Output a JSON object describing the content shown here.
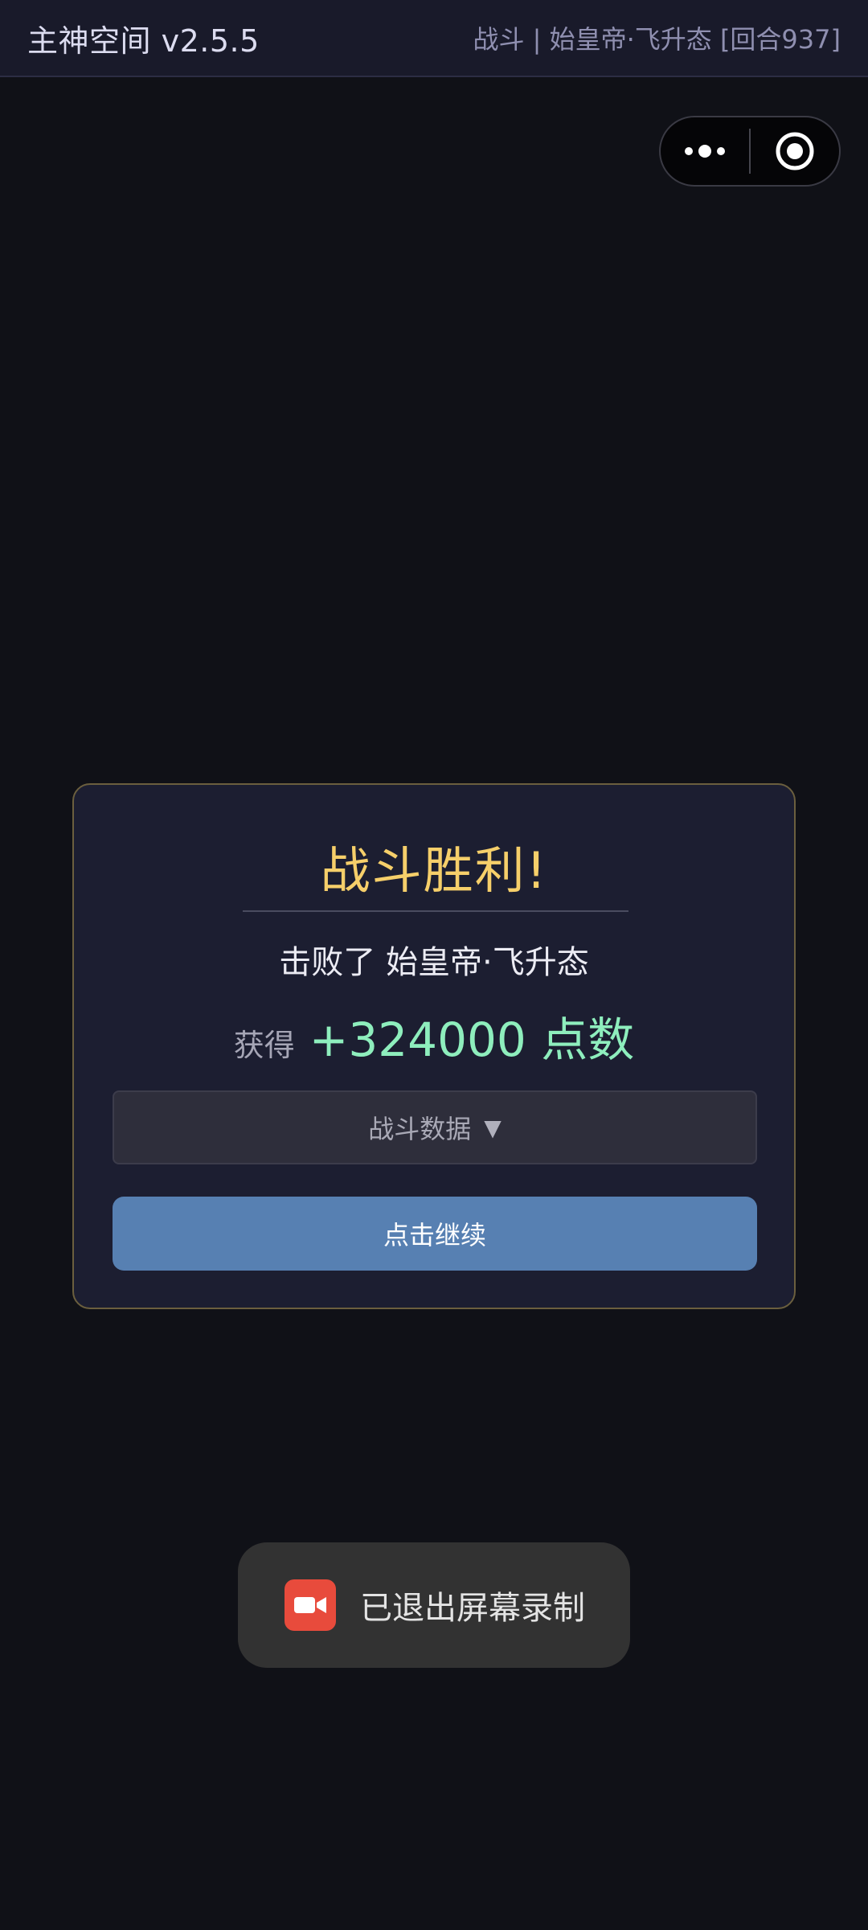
{
  "header": {
    "app_title": "主神空间 v2.5.5",
    "battle_status": "战斗 | 始皇帝·飞升态 [回合937]"
  },
  "capsule": {
    "more_icon": "more-dots-icon",
    "target_icon": "target-circle-icon"
  },
  "dialog": {
    "title": "战斗胜利!",
    "defeated_text": "击败了 始皇帝·飞升态",
    "reward_label": "获得",
    "reward_value": "+324000 点数",
    "stats_label": "战斗数据",
    "stats_caret": "▼",
    "continue_label": "点击继续"
  },
  "toast": {
    "icon": "video-camera-icon",
    "text": "已退出屏幕录制"
  },
  "colors": {
    "background": "#101117",
    "title_gold": "#f6cf6a",
    "reward_green": "#8eeebd",
    "button_blue": "#5780b2",
    "record_red": "#e84b3c"
  }
}
